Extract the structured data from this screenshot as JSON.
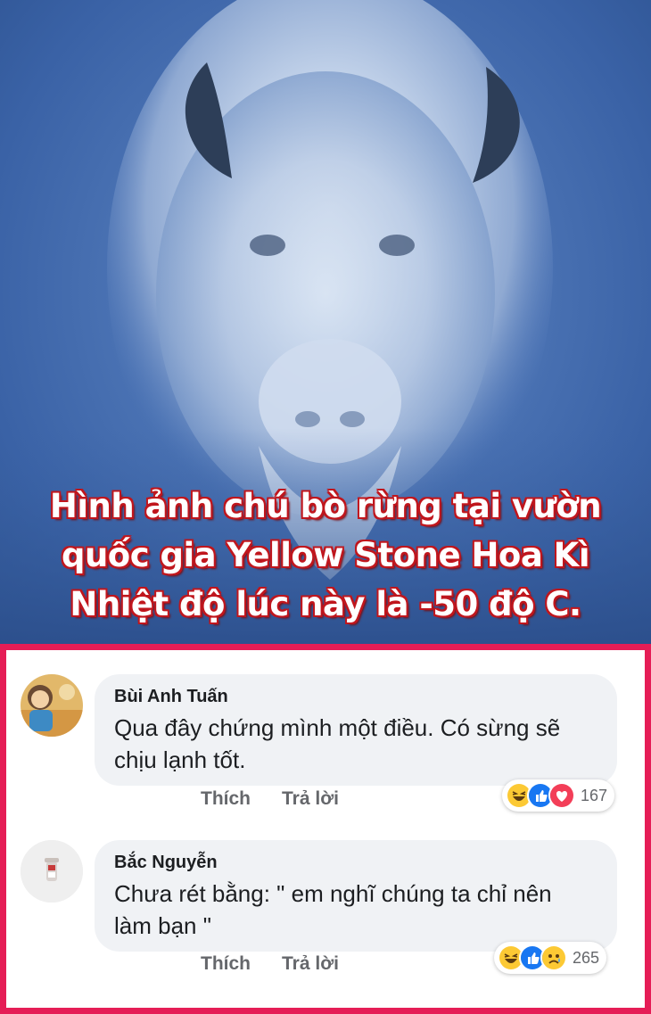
{
  "photo": {
    "caption_lines": [
      "Hình ảnh chú bò rừng tại vườn",
      "quốc gia Yellow Stone Hoa Kì",
      "Nhiệt độ lúc này là -50 độ C."
    ],
    "caption_color": "#ffffff",
    "caption_outline_color": "#c0161d"
  },
  "comments_panel": {
    "border_color": "#e51d56"
  },
  "comments": [
    {
      "author": "Bùi Anh Tuấn",
      "text_lines": [
        "Qua đây chứng mình một điều. Có sừng sẽ",
        "chịu lạnh tốt."
      ],
      "like_label": "Thích",
      "reply_label": "Trả lời",
      "reactions": [
        "haha-icon",
        "like-icon",
        "love-icon"
      ],
      "reaction_count": "167"
    },
    {
      "author": "Bắc Nguyễn",
      "text_lines": [
        "Chưa rét bằng: \" em nghĩ chúng ta chỉ nên",
        "làm bạn \""
      ],
      "like_label": "Thích",
      "reply_label": "Trả lời",
      "reactions": [
        "haha-icon",
        "like-icon",
        "sad-icon"
      ],
      "reaction_count": "265"
    }
  ]
}
